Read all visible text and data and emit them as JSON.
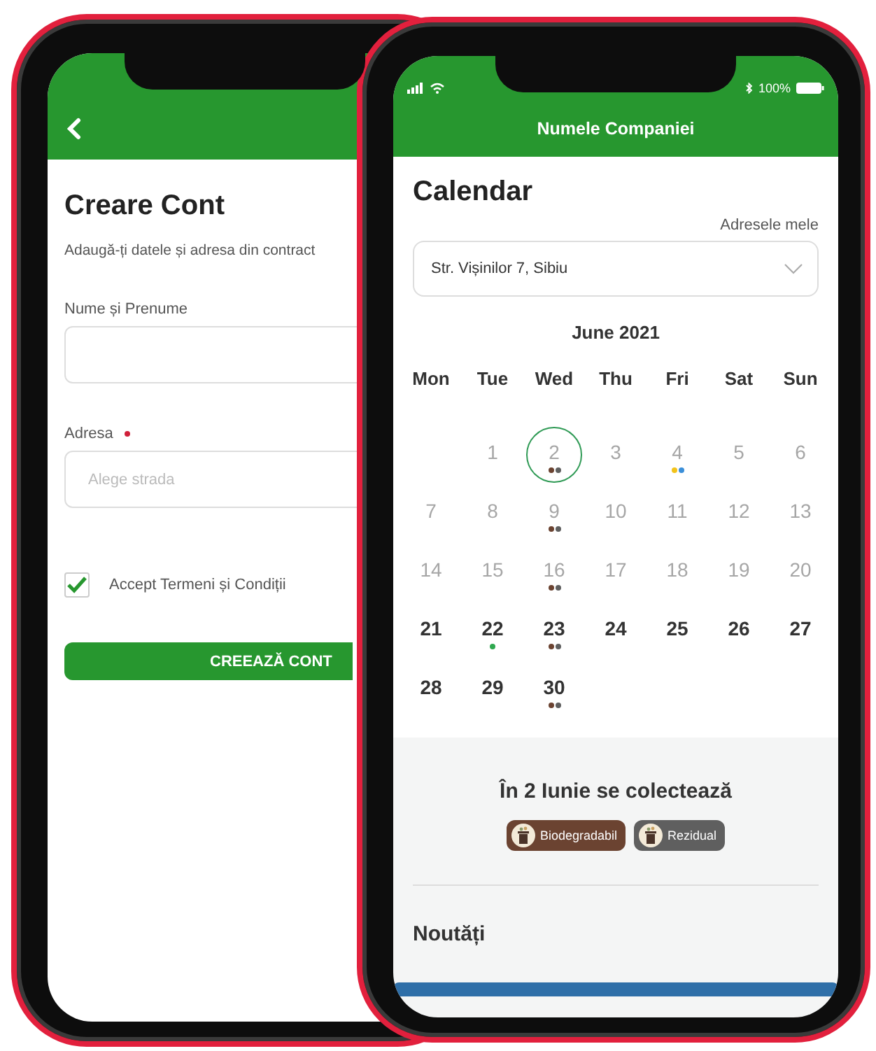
{
  "signup_screen": {
    "title": "Creare Cont",
    "subtitle": "Adaugă-ți datele și adresa din contract",
    "fields": [
      {
        "label": "Nume și Prenume",
        "required": false
      },
      {
        "label": "Adresa",
        "required": true,
        "placeholder": "Alege strada"
      }
    ],
    "terms": {
      "label": "Accept Termeni și Condiții",
      "checked": true
    },
    "submit_button": "CREEAZĂ CONT"
  },
  "calendar_screen": {
    "status_bar": {
      "battery": "100%"
    },
    "header_title": "Numele Companiei",
    "title": "Calendar",
    "addresses_link": "Adresele mele",
    "address_select": {
      "value": "Str. Vișinilor 7, Sibiu"
    },
    "month": "June 2021",
    "weekdays": [
      "Mon",
      "Tue",
      "Wed",
      "Thu",
      "Fri",
      "Sat",
      "Sun"
    ],
    "weeks": [
      [
        {
          "kind": "blank"
        },
        {
          "kind": "day",
          "label": "1",
          "past": true,
          "selected": false
        },
        {
          "kind": "day",
          "label": "2",
          "past": true,
          "selected": true,
          "dots": [
            {
              "color": "#6b4331"
            },
            {
              "color": "#5f5f5f"
            }
          ]
        },
        {
          "kind": "day",
          "label": "3",
          "past": true,
          "selected": false
        },
        {
          "kind": "day",
          "label": "4",
          "past": true,
          "selected": false,
          "dots": [
            {
              "color": "#f2c31b"
            },
            {
              "color": "#3b8fd9"
            }
          ]
        },
        {
          "kind": "day",
          "label": "5",
          "past": true,
          "selected": false
        },
        {
          "kind": "day",
          "label": "6",
          "past": true,
          "selected": false
        }
      ],
      [
        {
          "kind": "day",
          "label": "7",
          "past": true,
          "selected": false
        },
        {
          "kind": "day",
          "label": "8",
          "past": true,
          "selected": false
        },
        {
          "kind": "day",
          "label": "9",
          "past": true,
          "selected": false,
          "dots": [
            {
              "color": "#6b4331"
            },
            {
              "color": "#5f5f5f"
            }
          ]
        },
        {
          "kind": "day",
          "label": "10",
          "past": true,
          "selected": false
        },
        {
          "kind": "day",
          "label": "11",
          "past": true,
          "selected": false
        },
        {
          "kind": "day",
          "label": "12",
          "past": true,
          "selected": false
        },
        {
          "kind": "day",
          "label": "13",
          "past": true,
          "selected": false
        }
      ],
      [
        {
          "kind": "day",
          "label": "14",
          "past": true,
          "selected": false
        },
        {
          "kind": "day",
          "label": "15",
          "past": true,
          "selected": false
        },
        {
          "kind": "day",
          "label": "16",
          "past": true,
          "selected": false,
          "dots": [
            {
              "color": "#6b4331"
            },
            {
              "color": "#5f5f5f"
            }
          ]
        },
        {
          "kind": "day",
          "label": "17",
          "past": true,
          "selected": false
        },
        {
          "kind": "day",
          "label": "18",
          "past": true,
          "selected": false
        },
        {
          "kind": "day",
          "label": "19",
          "past": true,
          "selected": false
        },
        {
          "kind": "day",
          "label": "20",
          "past": true,
          "selected": false
        }
      ],
      [
        {
          "kind": "day",
          "label": "21",
          "past": false,
          "selected": false
        },
        {
          "kind": "day",
          "label": "22",
          "past": false,
          "selected": false,
          "dots": [
            {
              "color": "#2fa84f"
            }
          ]
        },
        {
          "kind": "day",
          "label": "23",
          "past": false,
          "selected": false,
          "dots": [
            {
              "color": "#6b4331"
            },
            {
              "color": "#5f5f5f"
            }
          ]
        },
        {
          "kind": "day",
          "label": "24",
          "past": false,
          "selected": false
        },
        {
          "kind": "day",
          "label": "25",
          "past": false,
          "selected": false
        },
        {
          "kind": "day",
          "label": "26",
          "past": false,
          "selected": false
        },
        {
          "kind": "day",
          "label": "27",
          "past": false,
          "selected": false
        }
      ],
      [
        {
          "kind": "day",
          "label": "28",
          "past": false,
          "selected": false
        },
        {
          "kind": "day",
          "label": "29",
          "past": false,
          "selected": false
        },
        {
          "kind": "day",
          "label": "30",
          "past": false,
          "selected": false,
          "dots": [
            {
              "color": "#6b4331"
            },
            {
              "color": "#5f5f5f"
            }
          ]
        }
      ]
    ],
    "collection": {
      "heading": "În 2 Iunie se colectează",
      "tags": [
        {
          "label": "Biodegradabil",
          "color": "#6b4331"
        },
        {
          "label": "Rezidual",
          "color": "#5f5f5f"
        }
      ]
    },
    "news_title": "Noutăți"
  }
}
